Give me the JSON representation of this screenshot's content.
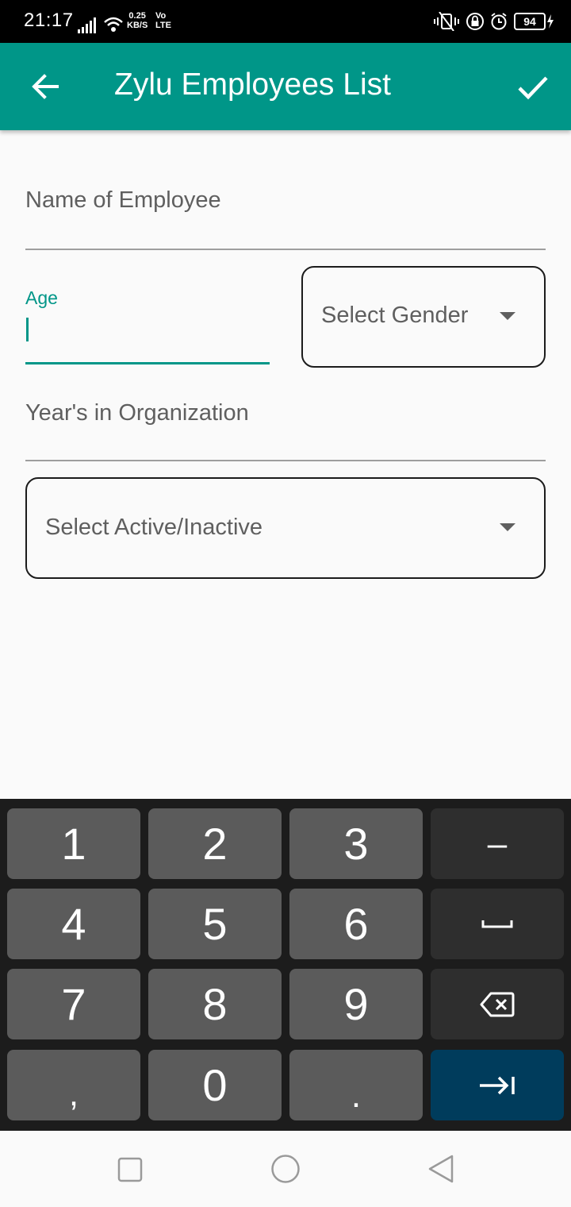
{
  "status_bar": {
    "time": "21:17",
    "speed_value": "0.25",
    "speed_unit": "KB/S",
    "volte_top": "Vo",
    "volte_bottom": "LTE",
    "battery": "94"
  },
  "app_bar": {
    "title": "Zylu Employees List",
    "back_icon": "arrow-left-icon",
    "confirm_icon": "check-icon"
  },
  "form": {
    "name_label": "Name of Employee",
    "age_label": "Age",
    "gender_placeholder": "Select Gender",
    "years_label": "Year's in Organization",
    "status_placeholder": "Select Active/Inactive"
  },
  "keyboard": {
    "row1": [
      "1",
      "2",
      "3",
      "–"
    ],
    "row2": [
      "4",
      "5",
      "6"
    ],
    "row3": [
      "7",
      "8",
      "9"
    ],
    "row4": [
      ",",
      "0",
      "."
    ],
    "space_icon": "space-icon",
    "backspace_icon": "backspace-icon",
    "next_icon": "tab-next-icon"
  },
  "nav_bar": {
    "recents_icon": "square-icon",
    "home_icon": "circle-icon",
    "back_icon": "triangle-back-icon"
  },
  "colors": {
    "primary": "#009688",
    "keyboard_bg": "#1c1c1c",
    "key": "#5b5b5b",
    "key_dark": "#2e2e2e",
    "key_enter": "#003c5c"
  }
}
